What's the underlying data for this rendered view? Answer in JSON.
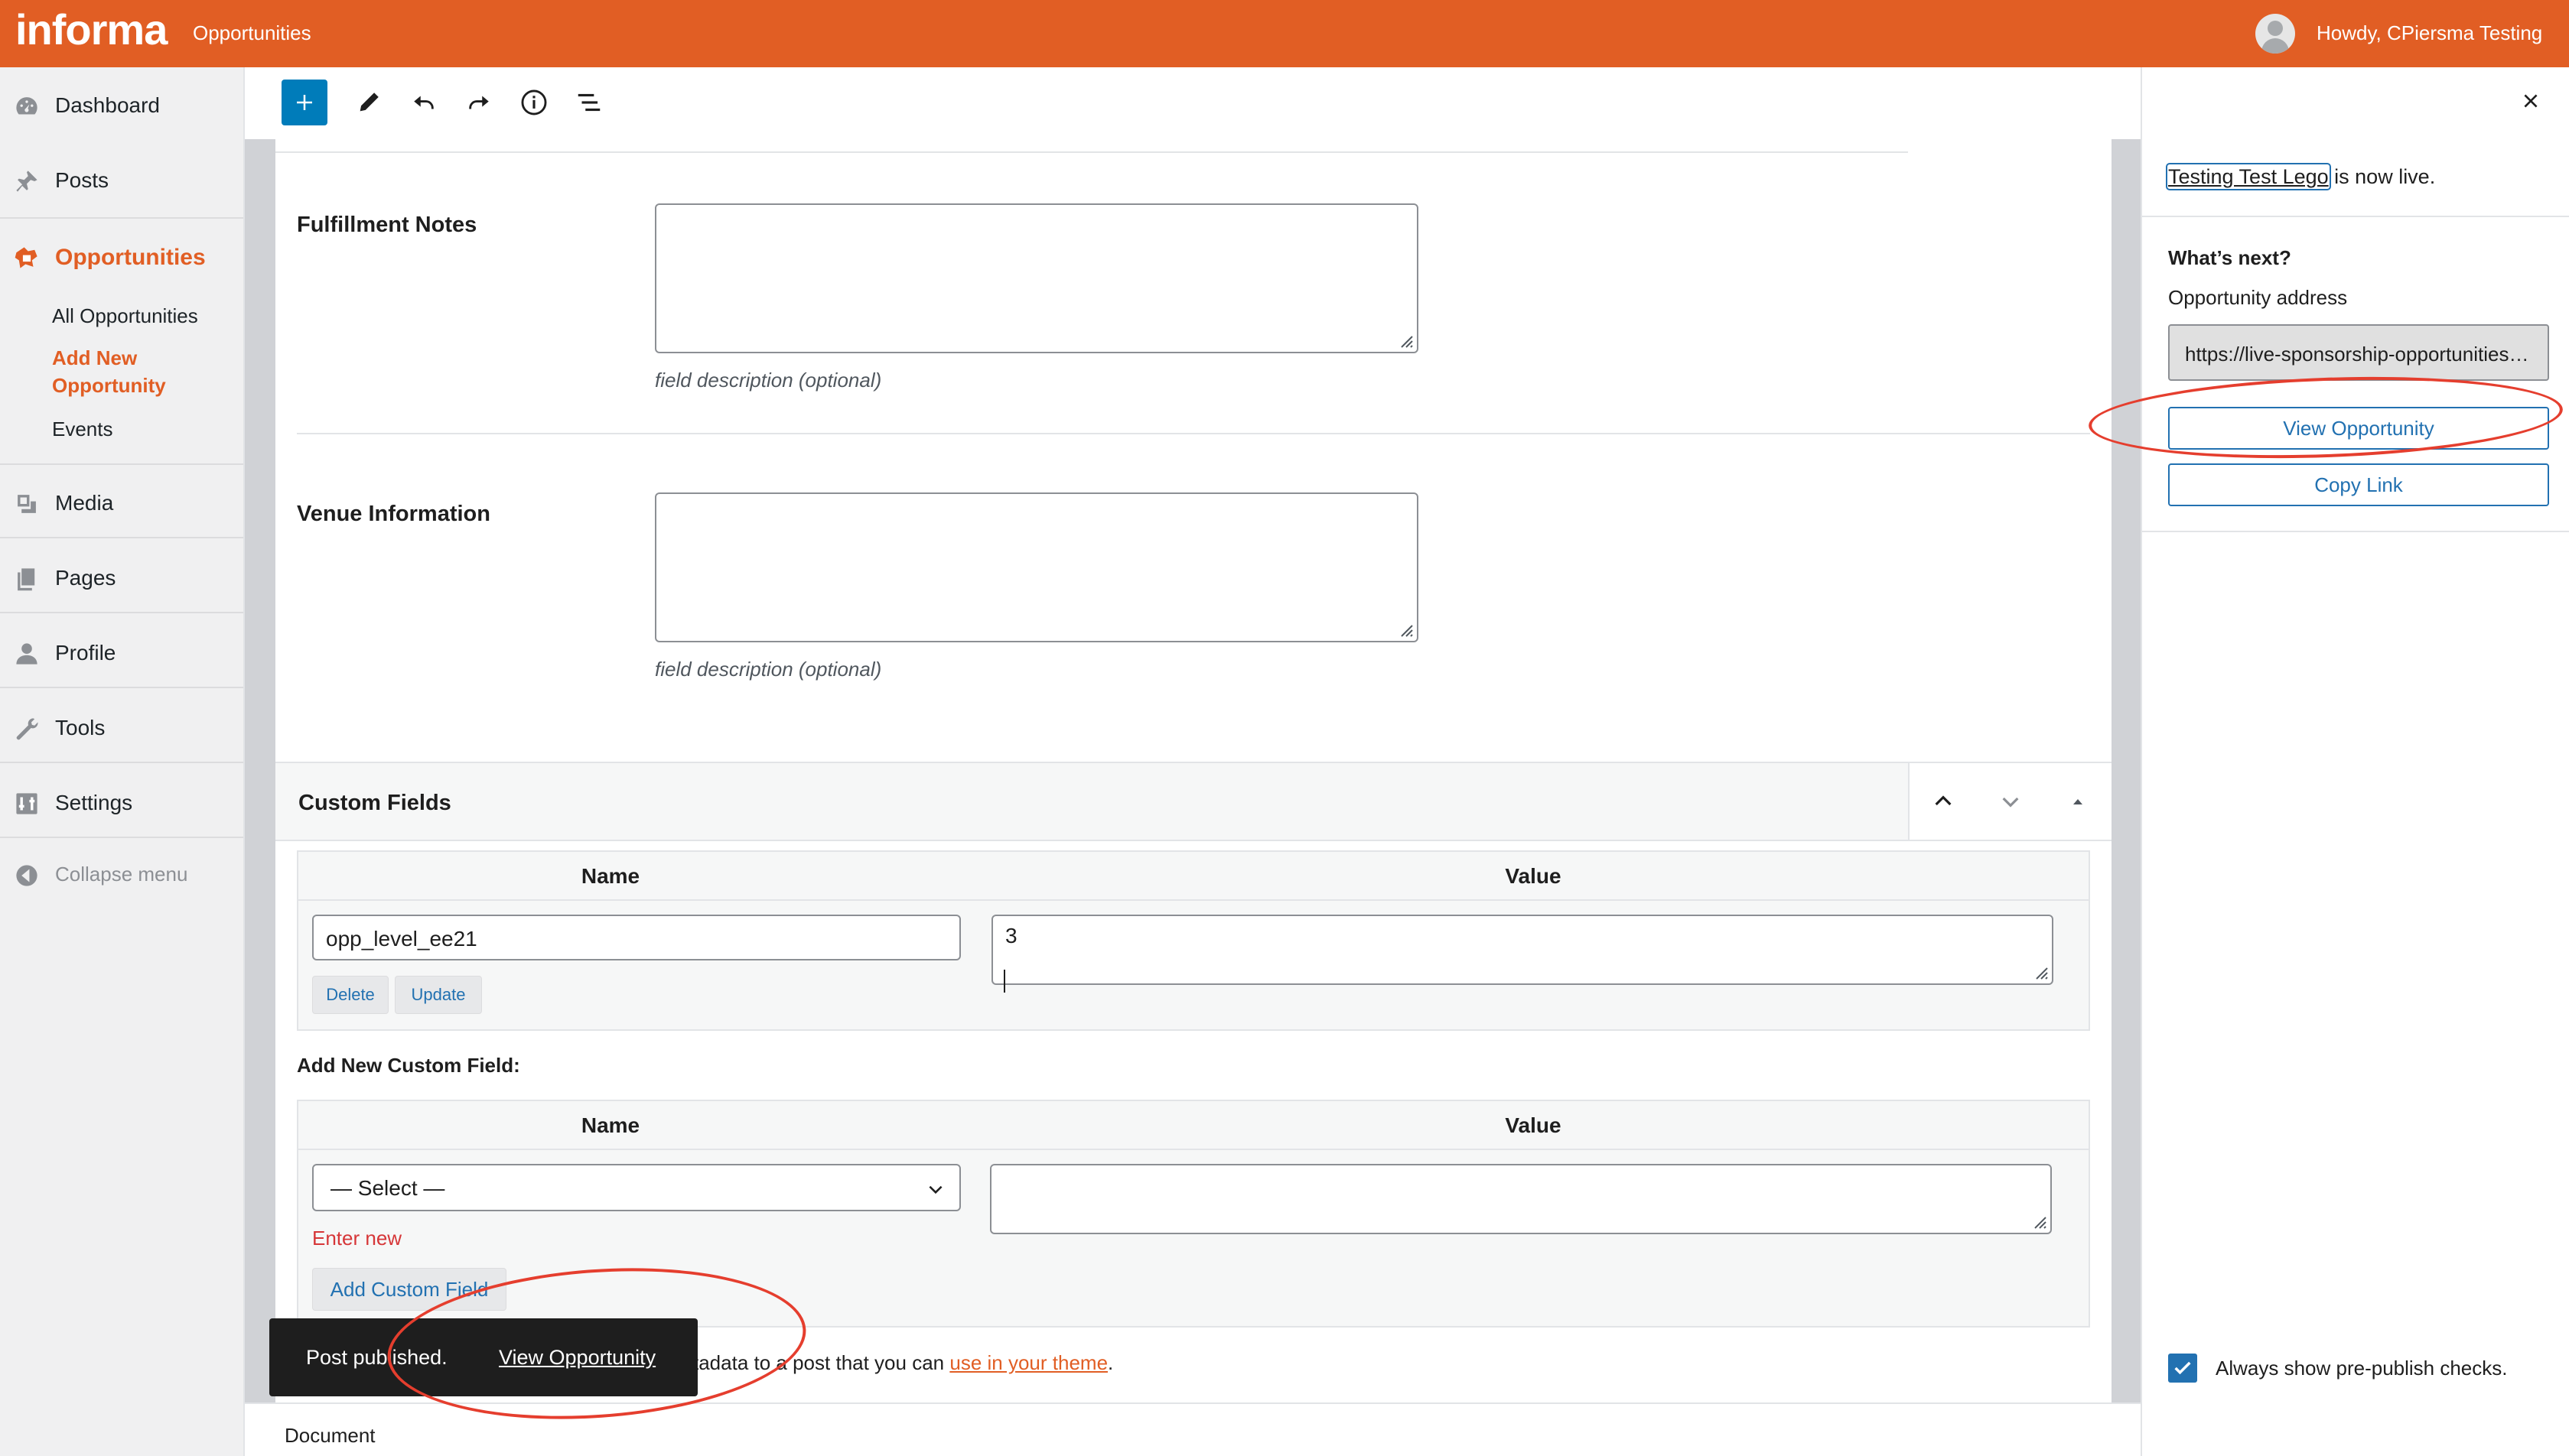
{
  "adminbar": {
    "logo": "informa",
    "site_link": "Opportunities",
    "howdy": "Howdy, CPiersma Testing"
  },
  "menu": {
    "items": [
      {
        "label": "Dashboard",
        "icon": "dashboard-icon"
      },
      {
        "label": "Posts",
        "icon": "pin-icon"
      },
      {
        "label": "Opportunities",
        "icon": "opportunities-icon"
      },
      {
        "label": "Media",
        "icon": "media-icon"
      },
      {
        "label": "Pages",
        "icon": "pages-icon"
      },
      {
        "label": "Profile",
        "icon": "profile-icon"
      },
      {
        "label": "Tools",
        "icon": "wrench-icon"
      },
      {
        "label": "Settings",
        "icon": "settings-icon"
      }
    ],
    "submenu": {
      "all": "All Opportunities",
      "add_new_1": "Add New",
      "add_new_2": "Opportunity",
      "events": "Events"
    },
    "collapse": "Collapse menu"
  },
  "toolbar": {
    "icons": [
      "plus-icon",
      "pencil-icon",
      "undo-icon",
      "redo-icon",
      "info-icon",
      "list-view-icon"
    ]
  },
  "fields": {
    "fulfillment_label": "Fulfillment Notes",
    "venue_label": "Venue Information",
    "description": "field description (optional)"
  },
  "custom_fields": {
    "title": "Custom Fields",
    "name_header": "Name",
    "value_header": "Value",
    "row": {
      "name": "opp_level_ee21",
      "value": "3"
    },
    "delete": "Delete",
    "update": "Update",
    "add_new_label": "Add New Custom Field:",
    "select_placeholder": "— Select —",
    "enter_new": "Enter new",
    "add_button": "Add Custom Field",
    "help_prefix": "tadata to a post that you can ",
    "help_link": "use in your theme",
    "help_suffix": "."
  },
  "snackbar": {
    "text": "Post published.",
    "link": "View Opportunity"
  },
  "footer": {
    "breadcrumb": "Document"
  },
  "panel": {
    "post_title": "Testing Test Lego",
    "live_suffix": " is now live.",
    "whats_next": "What’s next?",
    "address_label": "Opportunity address",
    "address_value": "https://live-sponsorship-opportunities.pantheonsite.io/opportunities/testing-test-lego/",
    "view_button": "View Opportunity",
    "copy_button": "Copy Link",
    "checkbox_label": "Always show pre-publish checks.",
    "checkbox_checked": true
  },
  "colors": {
    "brand": "#e15e24",
    "link": "#2271b1",
    "annotation": "#e53e2e"
  }
}
